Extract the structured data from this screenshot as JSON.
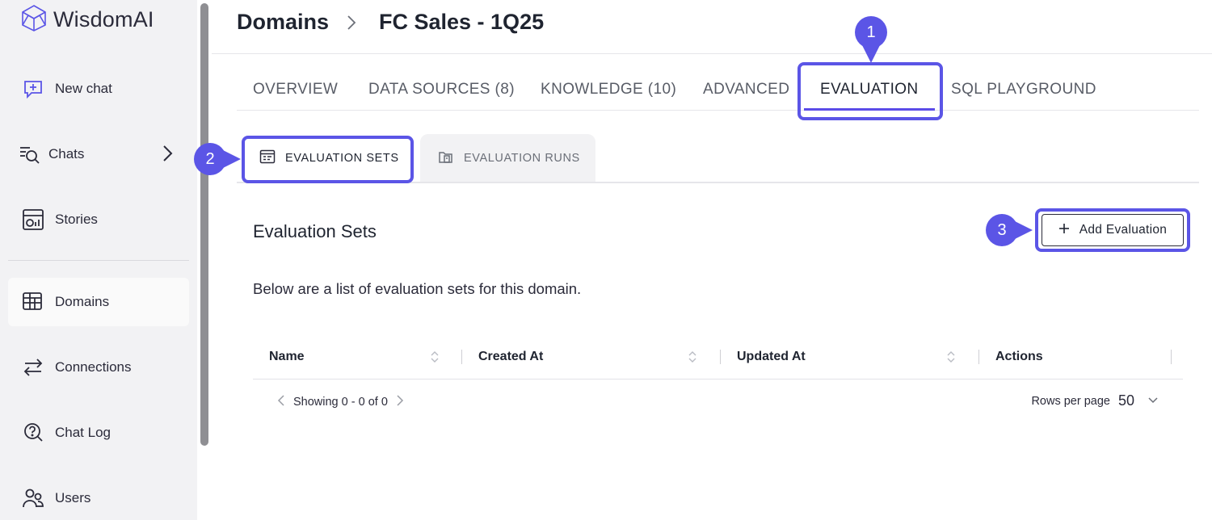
{
  "brand": {
    "name": "WisdomAI"
  },
  "sidebar": {
    "items": [
      {
        "label": "New chat",
        "icon": "new-chat-icon"
      },
      {
        "label": "Chats",
        "icon": "chats-search-icon"
      },
      {
        "label": "Stories",
        "icon": "stories-icon"
      },
      {
        "label": "Domains",
        "icon": "domains-table-icon"
      },
      {
        "label": "Connections",
        "icon": "connections-arrows-icon"
      },
      {
        "label": "Chat Log",
        "icon": "chat-log-icon"
      },
      {
        "label": "Users",
        "icon": "users-icon"
      }
    ]
  },
  "header": {
    "breadcrumb": [
      "Domains",
      "FC Sales - 1Q25"
    ]
  },
  "tabs": [
    "OVERVIEW",
    "DATA SOURCES (8)",
    "KNOWLEDGE (10)",
    "ADVANCED",
    "EVALUATION",
    "SQL PLAYGROUND"
  ],
  "subtabs": [
    "EVALUATION SETS",
    "EVALUATION RUNS"
  ],
  "main": {
    "title": "Evaluation Sets",
    "add_button": "Add Evaluation",
    "description": "Below are a list of evaluation sets for this domain.",
    "columns": [
      "Name",
      "Created At",
      "Updated At",
      "Actions"
    ]
  },
  "pagination": {
    "showing": "Showing 0 - 0 of 0",
    "rows_label": "Rows per page",
    "rows_value": "50"
  },
  "markers": [
    "1",
    "2",
    "3"
  ],
  "colors": {
    "accent": "#5b55e6",
    "sidebar_bg": "#f2f2f4"
  }
}
